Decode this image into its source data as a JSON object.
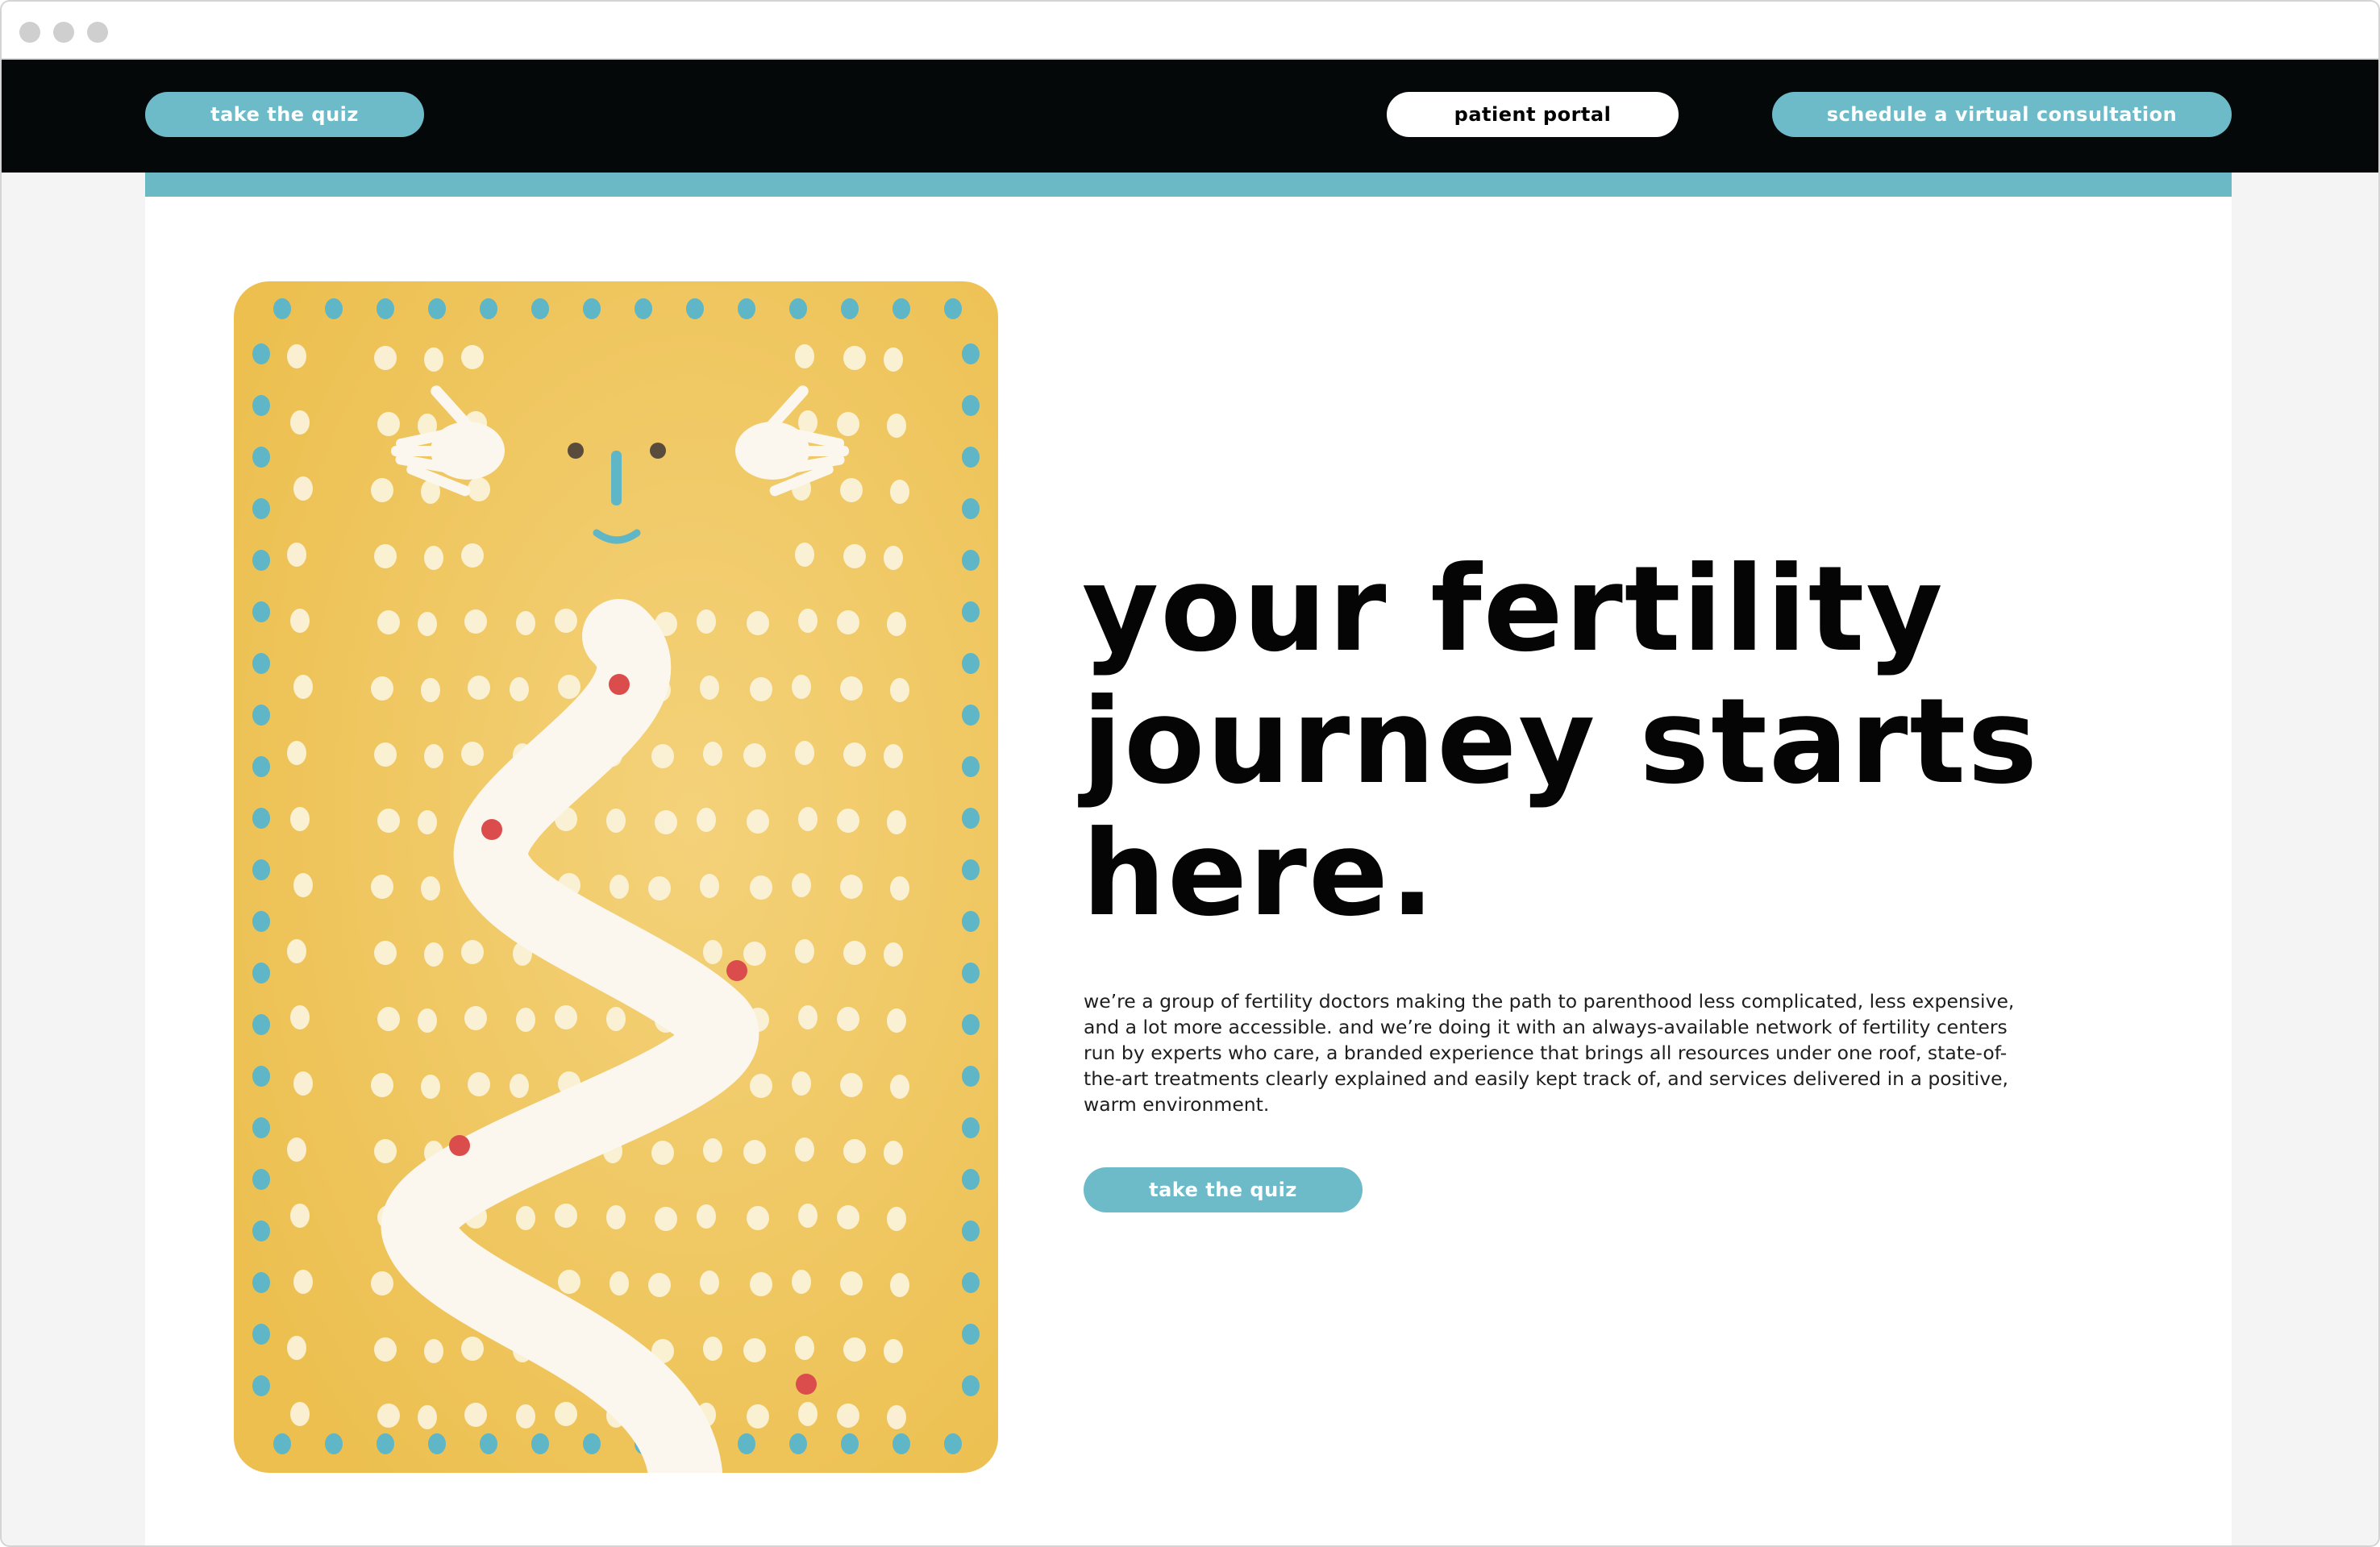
{
  "nav": {
    "quiz_label": "take the quiz",
    "portal_label": "patient portal",
    "consult_label": "schedule a virtual consultation"
  },
  "hero": {
    "headline_line1": "your fertility",
    "headline_line2": "journey starts",
    "headline_line3": "here.",
    "body": "we’re a group of fertility doctors making the path to parenthood less complicated, less expensive, and a lot more accessible. and we’re doing it with an always-available network of fertility centers run by experts who care, a branded experience that brings all resources under one roof, state-of-the-art treatments clearly explained and easily kept track of, and services delivered in a positive, warm environment.",
    "cta_label": "take the quiz"
  },
  "colors": {
    "accent_teal": "#6dbbc8",
    "nav_black": "#050809",
    "art_yellow": "#efc559",
    "path_red": "#db4c4c"
  }
}
